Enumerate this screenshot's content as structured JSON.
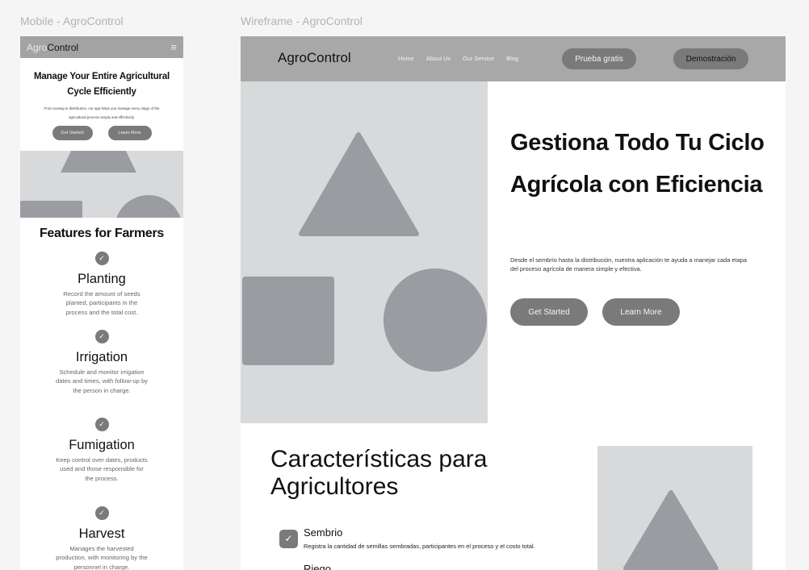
{
  "frames": {
    "mobile_label": "Mobile - AgroControl",
    "wire_label": "Wireframe - AgroControl"
  },
  "mobile": {
    "logo_a": "Agro",
    "logo_b": "Control",
    "menu_icon": "≡",
    "hero_title": "Manage Your Entire Agricultural Cycle Efficiently",
    "hero_sub": "From sowing to distribution, our app helps you manage every stage of the agricultural process simply and effectively.",
    "btn_start": "Get Started",
    "btn_learn": "Learn More",
    "features_title": "Features for Farmers",
    "features": [
      {
        "title": "Planting",
        "desc": "Record the amount of seeds planted, participants in the process and the total cost."
      },
      {
        "title": "Irrigation",
        "desc": "Schedule and monitor irrigation dates and times, with follow-up by the person in charge."
      },
      {
        "title": "Fumigation",
        "desc": "Keep control over dates, products used and those responsible for the process."
      },
      {
        "title": "Harvest",
        "desc": "Manages the harvested production, with monitoring by the personnel in charge."
      }
    ]
  },
  "wire": {
    "logo": "AgroControl",
    "nav": [
      "Home",
      "About Us",
      "Our Service",
      "Blog"
    ],
    "btn_trial": "Prueba gratis",
    "btn_demo": "Demostración",
    "hero_title": "Gestiona Todo Tu Ciclo Agrícola con Eficiencia",
    "hero_sub": "Desde el sembrío hasta la distribución, nuestra aplicación te ayuda a manejar cada etapa del proceso agrícola de manera simple y efectiva.",
    "btn_start": "Get Started",
    "btn_learn": "Learn More",
    "features_title": "Características para Agricultores",
    "item1_title": "Sembrio",
    "item1_desc": "Registra la cantidad de semillas sembradas, participantes en el proceso y el costo total.",
    "item2_title": "Riego"
  },
  "colors": {
    "nav_gray": "#a8a8a8",
    "button_gray": "#7a7a7a",
    "placeholder_bg": "#d8d9db",
    "shape_gray": "#9a9ca1"
  }
}
